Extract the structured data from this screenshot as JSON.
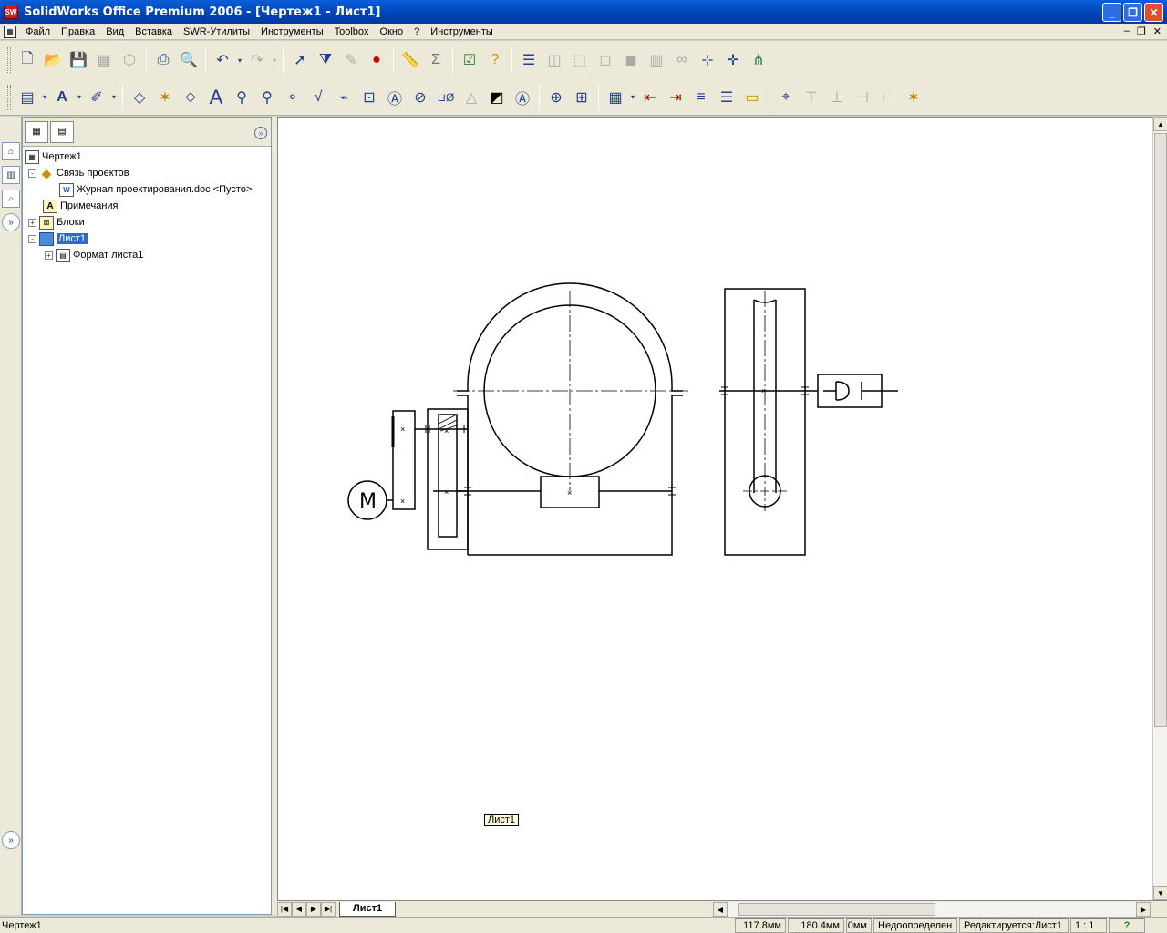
{
  "window": {
    "title": "SolidWorks Office Premium 2006 - [Чертеж1 - Лист1]",
    "logo_text": "SW"
  },
  "menu": {
    "items": [
      "Файл",
      "Правка",
      "Вид",
      "Вставка",
      "SWR-Утилиты",
      "Инструменты",
      "Toolbox",
      "Окно",
      "?",
      "Инструменты"
    ]
  },
  "feature_manager": {
    "tree": [
      {
        "label": "Чертеж1",
        "level": 0,
        "expander": ""
      },
      {
        "label": "Связь проектов",
        "level": 1,
        "expander": "-"
      },
      {
        "label": "Журнал проектирования.doc <Пусто>",
        "level": 2,
        "expander": ""
      },
      {
        "label": "Примечания",
        "level": 1,
        "expander": ""
      },
      {
        "label": "Блоки",
        "level": 1,
        "expander": "+"
      },
      {
        "label": "Лист1",
        "level": 1,
        "expander": "-"
      },
      {
        "label": "Формат листа1",
        "level": 2,
        "expander": "+"
      }
    ]
  },
  "drawing": {
    "motor_label": "M",
    "sheet_label": "Лист1"
  },
  "sheet_tabs": {
    "active": "Лист1"
  },
  "status": {
    "doc": "Чертеж1",
    "x": "117.8мм",
    "y": "180.4мм",
    "z": "0мм",
    "state": "Недоопределен",
    "editing": "Редактируется:Лист1",
    "scale": "1 : 1",
    "help": "?"
  }
}
